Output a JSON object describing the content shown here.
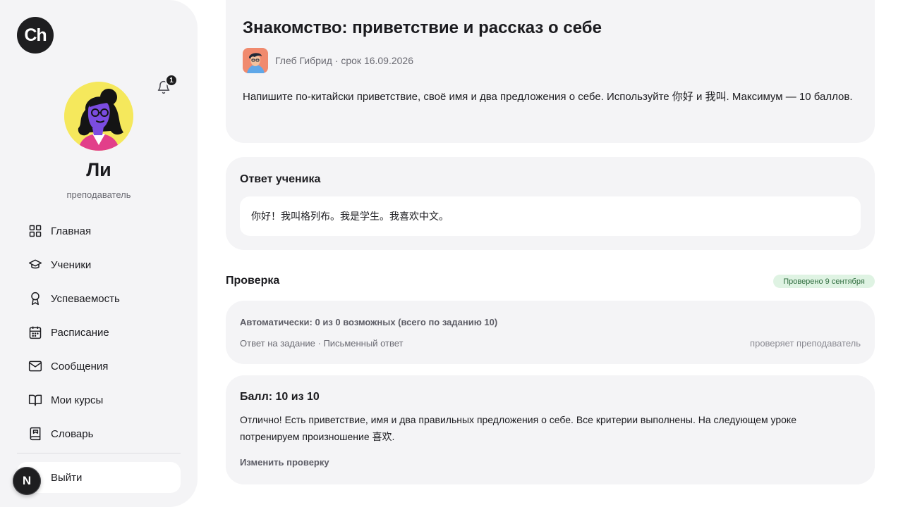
{
  "logo": {
    "text": "Ch"
  },
  "notifications": {
    "count": "1",
    "icon": "bell-icon"
  },
  "user": {
    "name": "Ли",
    "role": "преподаватель"
  },
  "nav": {
    "items": [
      {
        "label": "Главная",
        "icon": "grid-icon"
      },
      {
        "label": "Ученики",
        "icon": "graduation-cap-icon"
      },
      {
        "label": "Успеваемость",
        "icon": "award-icon"
      },
      {
        "label": "Расписание",
        "icon": "calendar-icon"
      },
      {
        "label": "Сообщения",
        "icon": "mail-icon"
      },
      {
        "label": "Мои курсы",
        "icon": "book-open-icon"
      },
      {
        "label": "Словарь",
        "icon": "dictionary-icon"
      }
    ],
    "logout": "Выйти",
    "corner_badge": "N"
  },
  "task": {
    "title": "Знакомство: приветствие и рассказ о себе",
    "author_meta": "Глеб Гибрид · срок 16.09.2026",
    "description": "Напишите по-китайски приветствие, своё имя и два предложения о себе. Используйте 你好 и 我叫. Максимум — 10 баллов."
  },
  "answer": {
    "title": "Ответ ученика",
    "text": "你好！我叫格列布。我是学生。我喜欢中文。"
  },
  "check": {
    "title": "Проверка",
    "status": "Проверено 9 сентября",
    "auto_line": "Автоматически: 0 из 0 возможных (всего по заданию 10)",
    "auto_meta": "Ответ на задание · Письменный ответ",
    "auto_right": "проверяет преподаватель"
  },
  "score": {
    "title": "Балл: 10 из 10",
    "comment": "Отлично! Есть приветствие, имя и два правильных предложения о себе. Все критерии выполнены. На следующем уроке потренируем произношение 喜欢.",
    "edit": "Изменить проверку"
  },
  "colors": {
    "sidebar_bg": "#f4f4f6",
    "card_bg": "#f4f4f6",
    "dark": "#1e1e20",
    "badge_green_bg": "#dff3e3",
    "badge_green_text": "#2d6b3c"
  }
}
